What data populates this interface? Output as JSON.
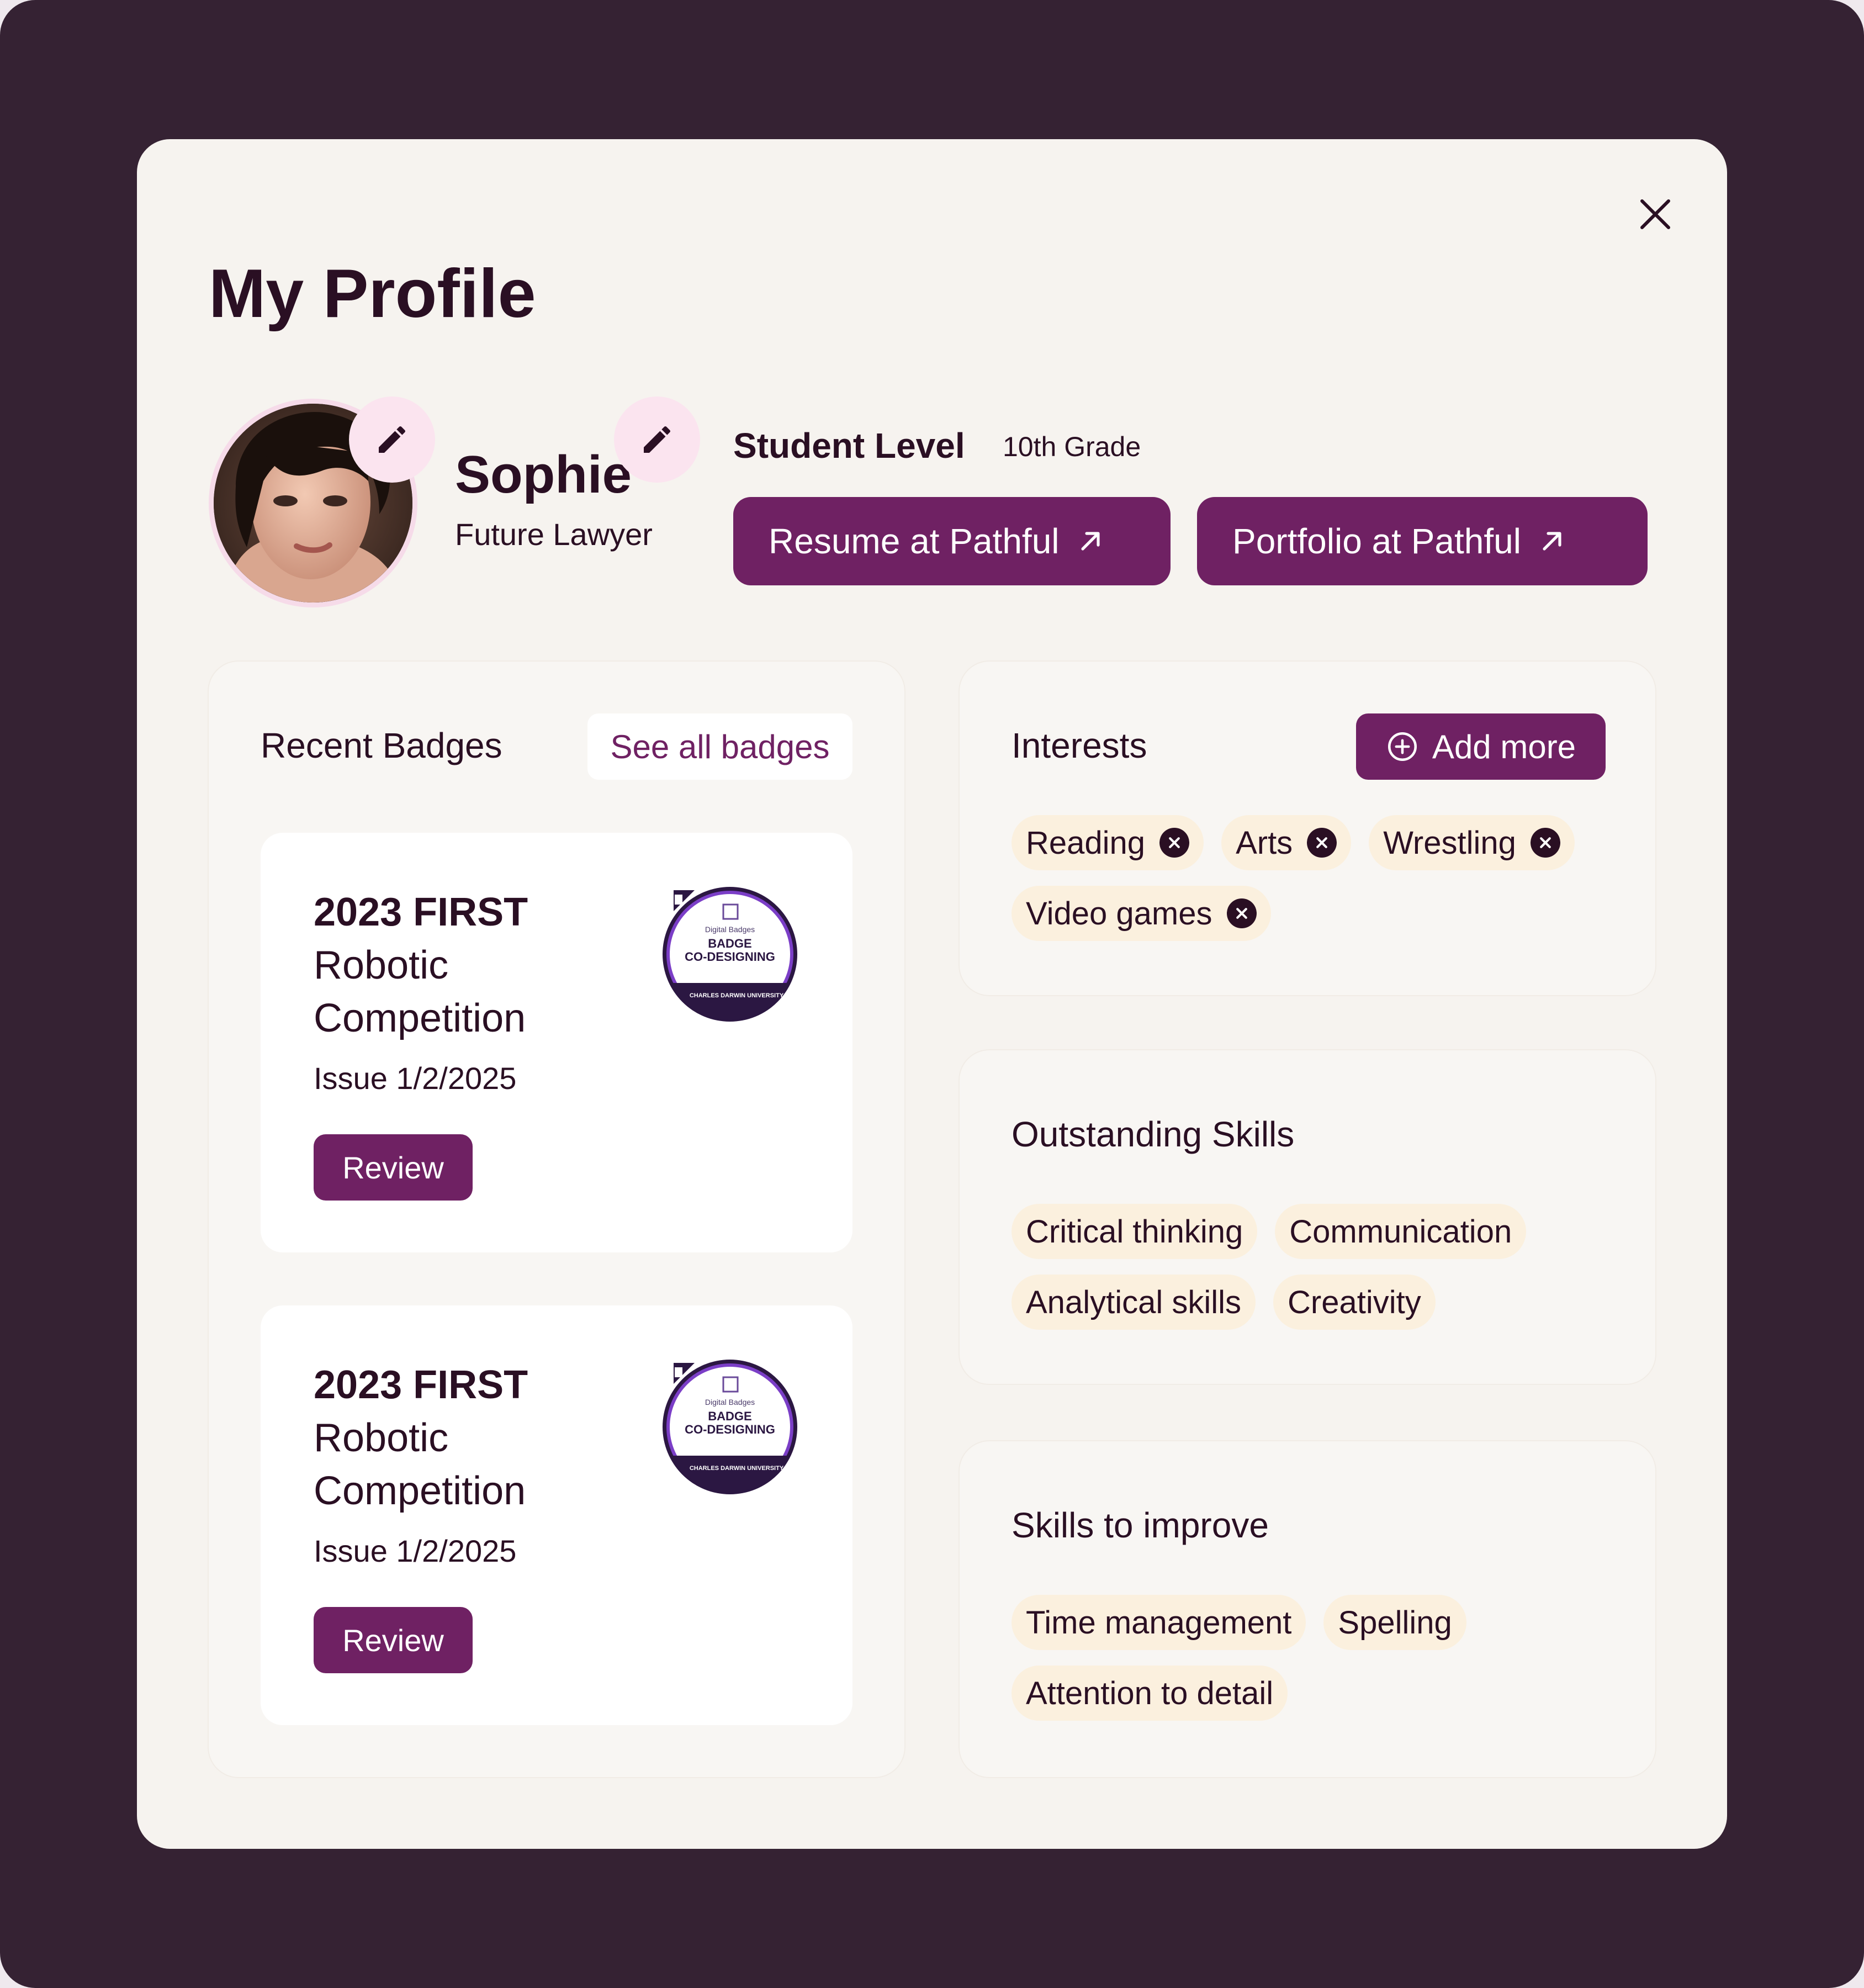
{
  "page": {
    "title": "My Profile"
  },
  "colors": {
    "accent": "#6f2163",
    "text": "#2a0f23",
    "chip_bg": "#fbf0de",
    "backdrop": "#352233",
    "modal_bg": "#f6f3ef"
  },
  "profile": {
    "name": "Sophie",
    "subtitle": "Future Lawyer",
    "student_level_label": "Student Level",
    "student_level_value": "10th Grade",
    "resume_label": "Resume at Pathful",
    "portfolio_label": "Portfolio at Pathful"
  },
  "badges": {
    "title": "Recent Badges",
    "see_all_label": "See all badges",
    "items": [
      {
        "title_line1": "2023 FIRST",
        "title_line2": "Robotic",
        "title_line3": "Competition",
        "issue": "Issue 1/2/2025",
        "review_label": "Review",
        "image": {
          "top_text": "Digital Badges",
          "line1": "BADGE",
          "line2": "CO-DESIGNING",
          "footer": "CHARLES DARWIN UNIVERSITY"
        }
      },
      {
        "title_line1": "2023 FIRST",
        "title_line2": "Robotic",
        "title_line3": "Competition",
        "issue": "Issue 1/2/2025",
        "review_label": "Review",
        "image": {
          "top_text": "Digital Badges",
          "line1": "BADGE",
          "line2": "CO-DESIGNING",
          "footer": "CHARLES DARWIN UNIVERSITY"
        }
      }
    ]
  },
  "interests": {
    "title": "Interests",
    "add_label": "Add more",
    "items": [
      "Reading",
      "Arts",
      "Wrestling",
      "Video games"
    ]
  },
  "outstanding_skills": {
    "title": "Outstanding Skills",
    "items": [
      "Critical thinking",
      "Communication",
      "Analytical skills",
      "Creativity"
    ]
  },
  "skills_to_improve": {
    "title": "Skills to improve",
    "items": [
      "Time management",
      "Spelling",
      "Attention to detail"
    ]
  },
  "icons": {
    "close": "close-icon",
    "edit": "pencil-icon",
    "external": "arrow-up-right-icon",
    "add": "plus-circle-icon",
    "remove": "x-circle-icon"
  }
}
